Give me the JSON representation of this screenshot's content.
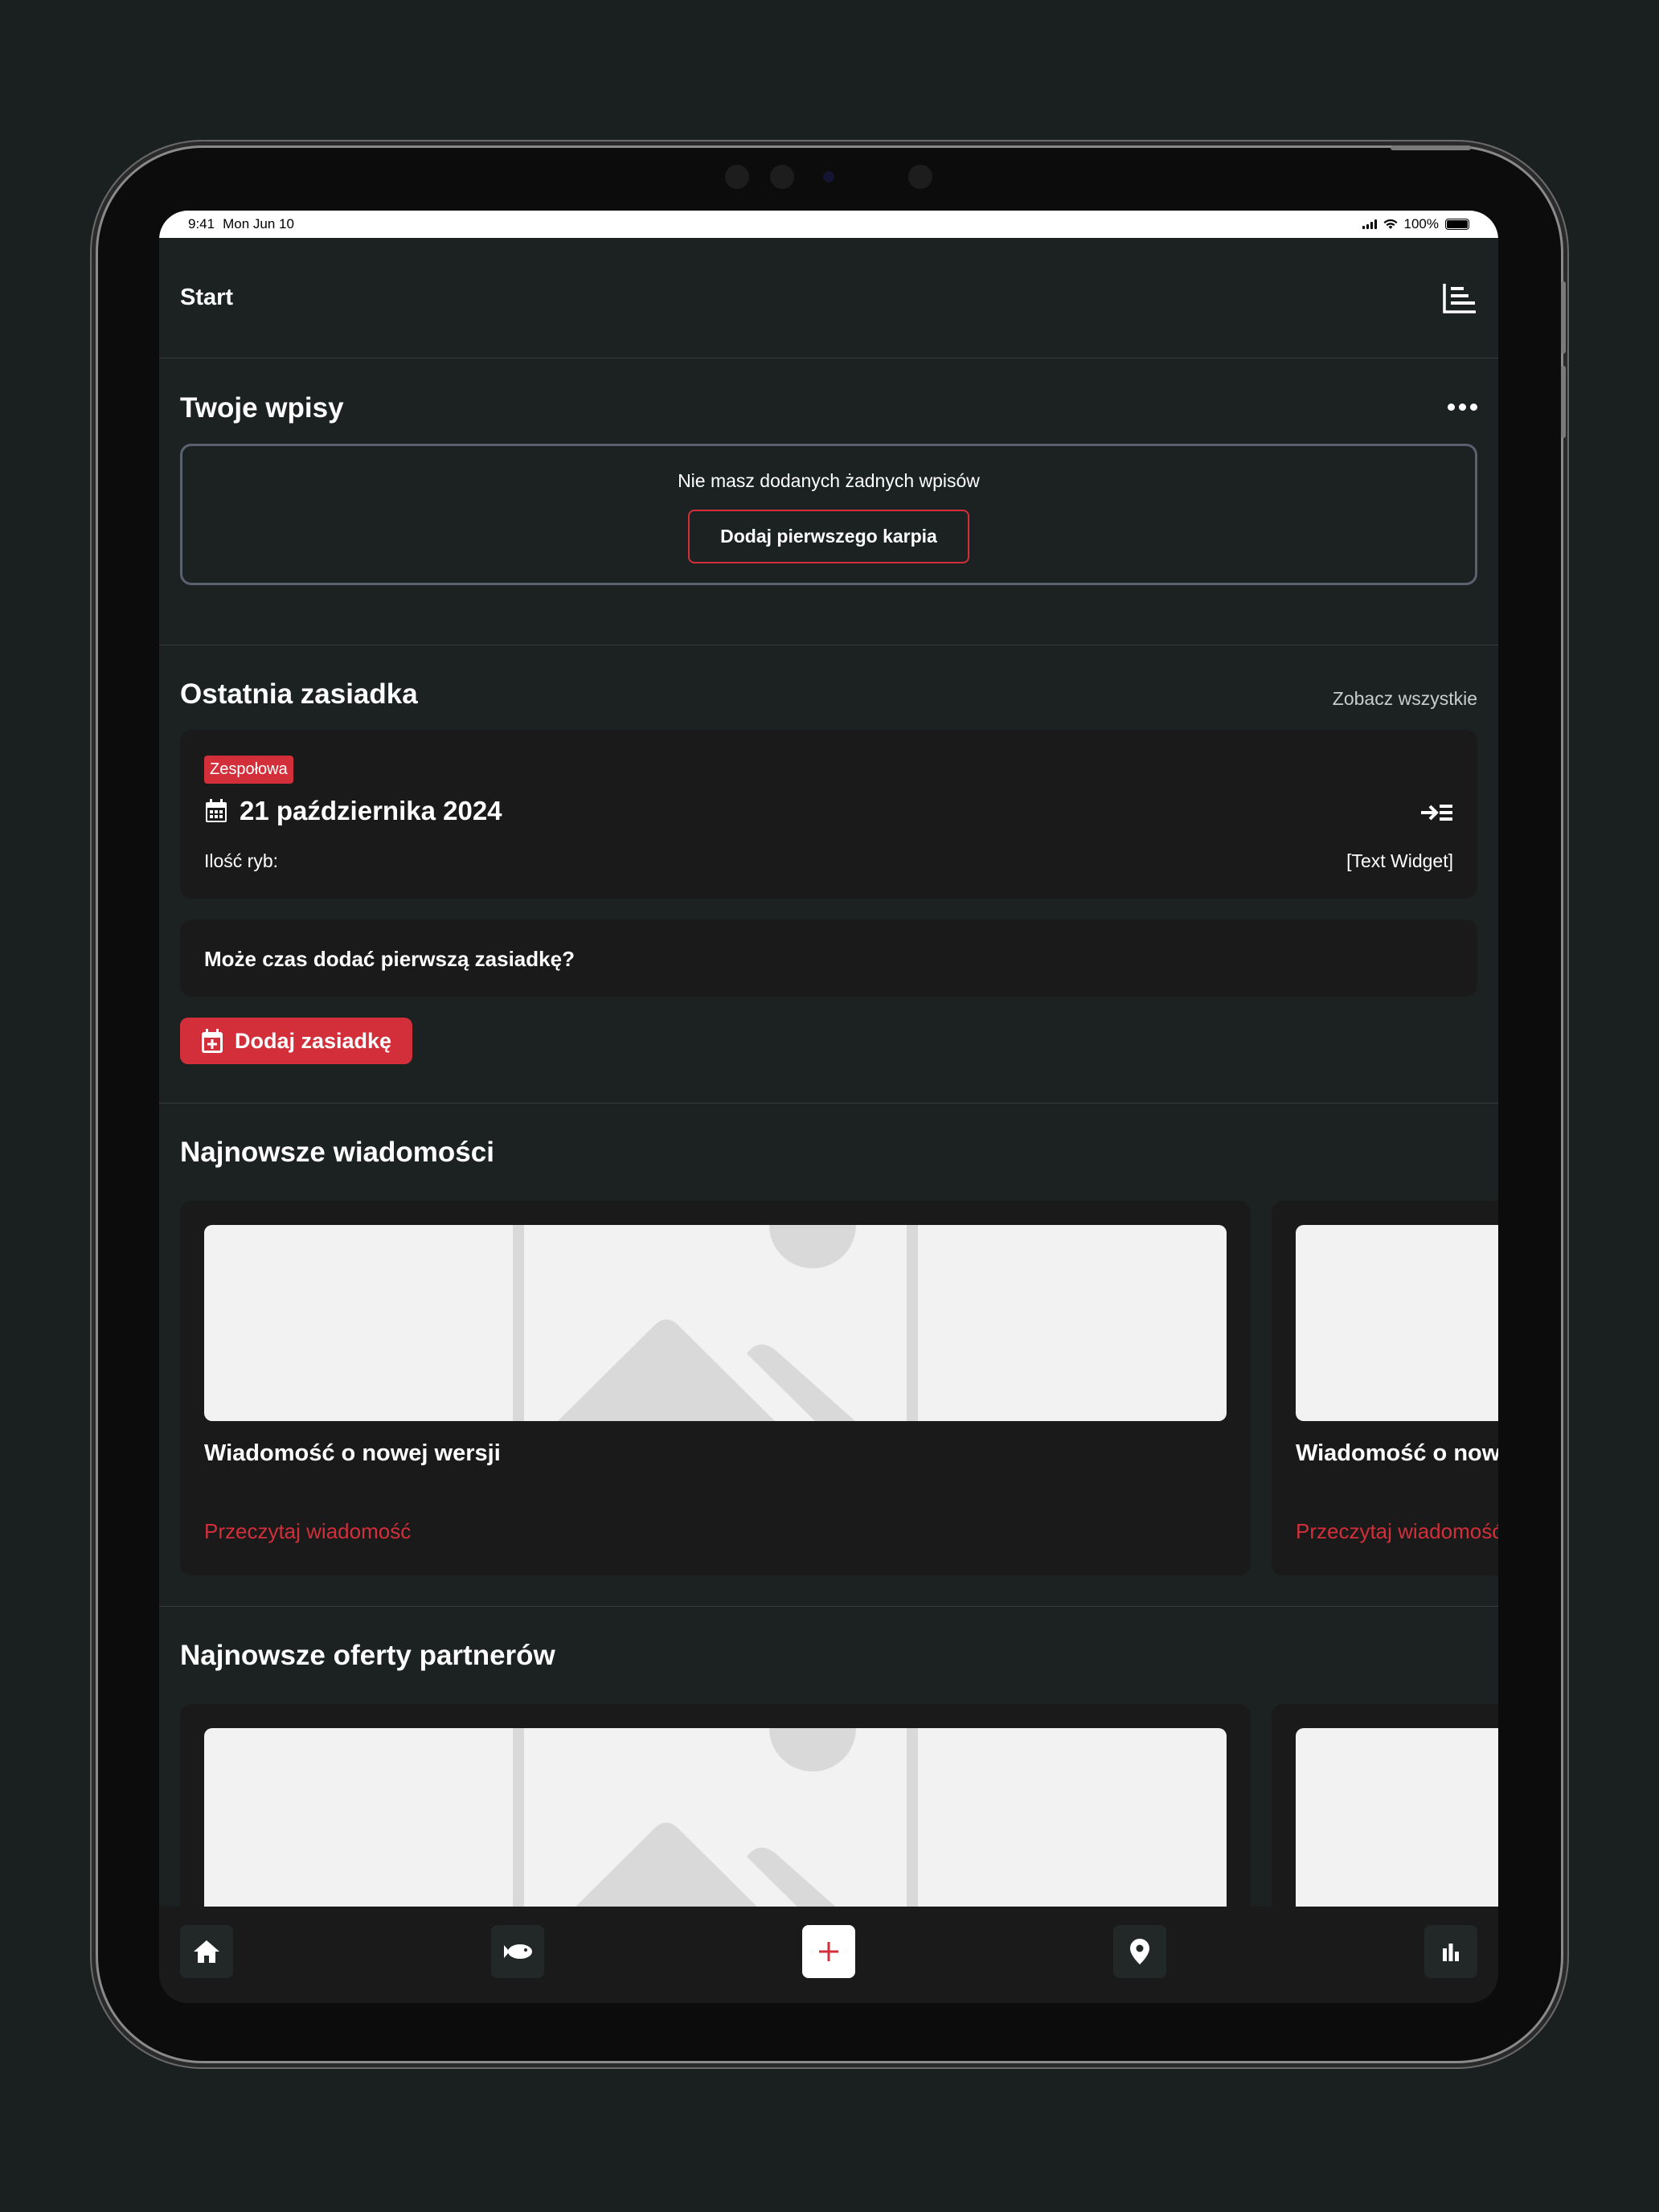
{
  "status_bar": {
    "time": "9:41",
    "date": "Mon Jun 10",
    "battery": "100%"
  },
  "app_bar": {
    "title": "Start",
    "menu_icon": "list-icon"
  },
  "entries": {
    "title": "Twoje wpisy",
    "empty_text": "Nie masz dodanych żadnych wpisów",
    "add_first_label": "Dodaj pierwszego karpia"
  },
  "last_session": {
    "title": "Ostatnia zasiadka",
    "see_all": "Zobacz wszystkie",
    "badge": "Zespołowa",
    "date": "21 października 2024",
    "fish_count_label": "Ilość ryb:",
    "fish_count_value": "[Text Widget]",
    "prompt": "Może czas dodać pierwszą zasiadkę?",
    "add_button": "Dodaj zasiadkę"
  },
  "news": {
    "title": "Najnowsze wiadomości",
    "items": [
      {
        "title": "Wiadomość o nowej wersji",
        "link": "Przeczytaj wiadomość"
      },
      {
        "title": "Wiadomość o nowej wersji",
        "link": "Przeczytaj wiadomość"
      }
    ]
  },
  "offers": {
    "title": "Najnowsze oferty partnerów"
  },
  "nav": [
    "home-icon",
    "fish-icon",
    "add-icon",
    "location-icon",
    "stats-icon"
  ],
  "colors": {
    "accent": "#d32f3a",
    "background": "#1c2222",
    "card": "#1a1a1a"
  }
}
